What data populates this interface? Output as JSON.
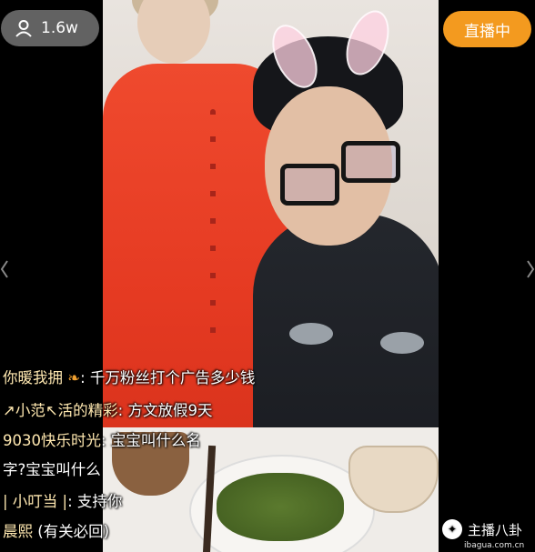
{
  "viewer": {
    "count": "1.6w",
    "icon": "user-icon"
  },
  "live_button": {
    "label": "直播中"
  },
  "comments": [
    {
      "name": "你暖我拥",
      "icon": "leaf-icon",
      "sep": ":",
      "text": "千万粉丝打个广告多少钱"
    },
    {
      "name": "↗小范↖活的精彩",
      "sep": ":",
      "text": "方文放假9天"
    },
    {
      "name": "9030快乐时光",
      "sep": ":",
      "text": "宝宝叫什么名"
    },
    {
      "name": "",
      "sep": "",
      "text": "字?宝宝叫什么"
    },
    {
      "name": "| 小叮当 |",
      "sep": ":",
      "text": "支持你"
    },
    {
      "name": "晨熙",
      "sep": "",
      "text": "(有关必回)"
    }
  ],
  "watermark": {
    "text": "主播八卦",
    "url": "ibagua.com.cn"
  },
  "colors": {
    "live": "#f39a1f",
    "pill": "#7a7a7a"
  }
}
